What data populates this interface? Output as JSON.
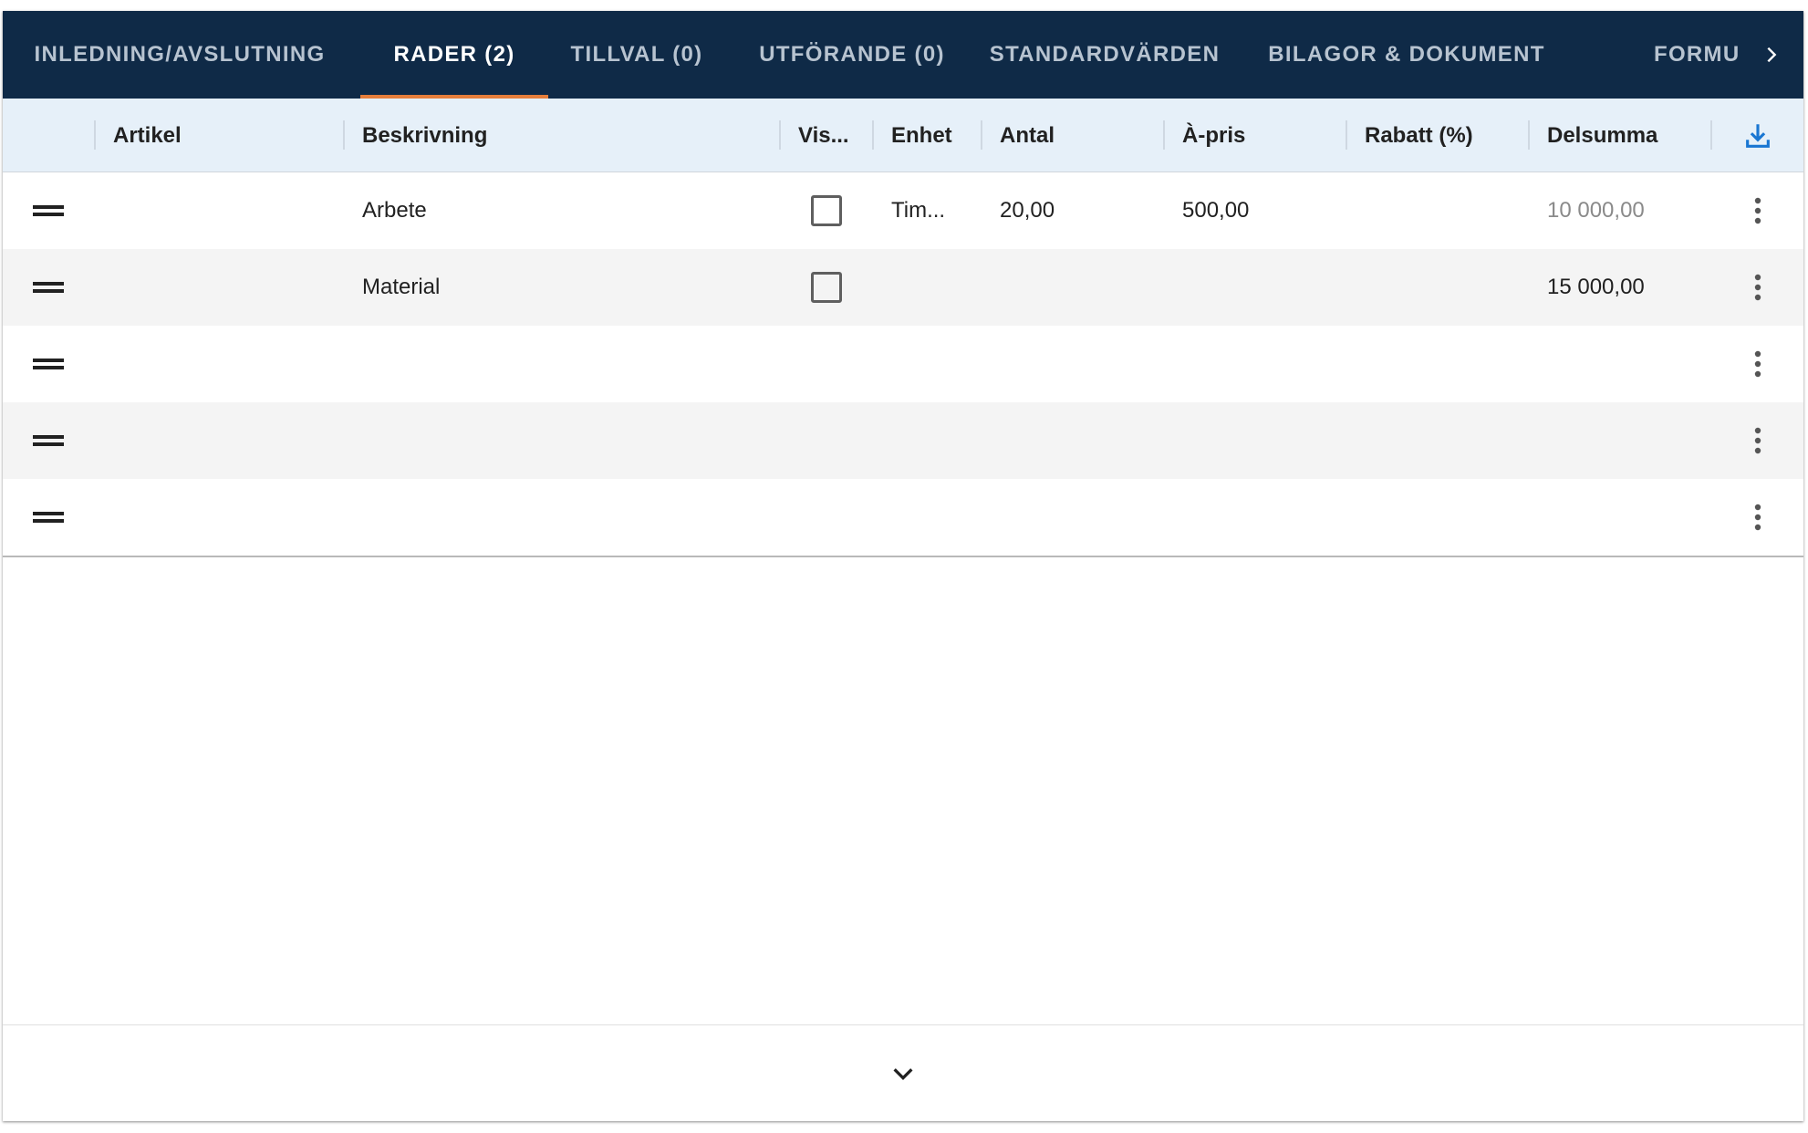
{
  "tabs": [
    {
      "label": "INLEDNING/AVSLUTNING",
      "active": false
    },
    {
      "label": "RADER (2)",
      "active": true
    },
    {
      "label": "TILLVAL (0)",
      "active": false
    },
    {
      "label": "UTFÖRANDE (0)",
      "active": false
    },
    {
      "label": "STANDARDVÄRDEN",
      "active": false
    },
    {
      "label": "BILAGOR & DOKUMENT",
      "active": false
    },
    {
      "label": "FORMU",
      "active": false
    }
  ],
  "tab_scroll_icon": "chevron-right-icon",
  "table": {
    "columns": [
      "Artikel",
      "Beskrivning",
      "Vis...",
      "Enhet",
      "Antal",
      "À-pris",
      "Rabatt (%)",
      "Delsumma"
    ],
    "export_icon": "download-icon",
    "rows": [
      {
        "artikel": "",
        "beskrivning": "Arbete",
        "visa": false,
        "enhet": "Tim...",
        "antal": "20,00",
        "apris": "500,00",
        "rabatt": "",
        "delsumma": "10 000,00",
        "delsumma_muted": true
      },
      {
        "artikel": "",
        "beskrivning": "Material",
        "visa": false,
        "enhet": "",
        "antal": "",
        "apris": "",
        "rabatt": "",
        "delsumma": "15 000,00",
        "delsumma_muted": false
      },
      {
        "artikel": "",
        "beskrivning": "",
        "enhet": "",
        "antal": "",
        "apris": "",
        "rabatt": "",
        "delsumma": ""
      },
      {
        "artikel": "",
        "beskrivning": "",
        "enhet": "",
        "antal": "",
        "apris": "",
        "rabatt": "",
        "delsumma": ""
      },
      {
        "artikel": "",
        "beskrivning": "",
        "enhet": "",
        "antal": "",
        "apris": "",
        "rabatt": "",
        "delsumma": ""
      }
    ]
  },
  "footer": {
    "expand_icon": "chevron-down-icon"
  },
  "colors": {
    "tabbar_bg": "#0f2a47",
    "tab_active_indicator": "#e67e3b",
    "header_bg": "#e6f0f9",
    "export_icon": "#1976d2"
  }
}
